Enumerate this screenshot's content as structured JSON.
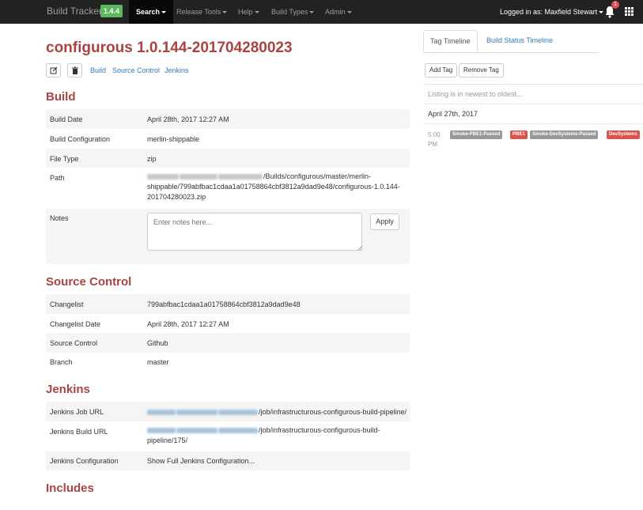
{
  "navbar": {
    "brand": "Build Tracker",
    "version": "1.4.4",
    "menu": [
      {
        "label": "Search",
        "active": true
      },
      {
        "label": "Release Tools",
        "active": false
      },
      {
        "label": "Help",
        "active": false
      },
      {
        "label": "Build Types",
        "active": false
      },
      {
        "label": "Admin",
        "active": false
      }
    ],
    "user": "Logged in as: Maxfield Stewart",
    "notification_count": "1"
  },
  "page": {
    "title": "configurous 1.0.144-201704280023",
    "toolbar_links": [
      "Build",
      "Source Control",
      "Jenkins"
    ]
  },
  "build": {
    "heading": "Build",
    "rows": [
      {
        "label": "Build Date",
        "value": "April 28th, 2017 12:27 AM"
      },
      {
        "label": "Build Configuration",
        "value": "merlin-shippable"
      },
      {
        "label": "File Type",
        "value": "zip"
      },
      {
        "label": "Path",
        "value": "/Builds/configurous/master/merlin-shippable/799abfbac1cdaa1a01758864cbf3812a9dad9e48/configurous-1.0.144-201704280023.zip"
      }
    ],
    "notes_label": "Notes",
    "notes_placeholder": "Enter notes here...",
    "apply_label": "Apply"
  },
  "source_control": {
    "heading": "Source Control",
    "rows": [
      {
        "label": "Changelist",
        "value": "799abfbac1cdaa1a01758864cbf3812a9dad9e48"
      },
      {
        "label": "Changelist Date",
        "value": "April 28th, 2017 12:27 AM"
      },
      {
        "label": "Source Control",
        "value": "Github"
      },
      {
        "label": "Branch",
        "value": "master"
      }
    ]
  },
  "jenkins": {
    "heading": "Jenkins",
    "job_url_label": "Jenkins Job URL",
    "job_url_value": "/job/infrastructurous-configurous-build-pipeline/",
    "build_url_label": "Jenkins Build URL",
    "build_url_value": "/job/infrastructurous-configurous-build-pipeline/175/",
    "config_label": "Jenkins Configuration",
    "config_link": "Show Full Jenkins Configuration..."
  },
  "includes": {
    "heading": "Includes"
  },
  "sidebar": {
    "tabs": [
      "Tag Timeline",
      "Build Status Timeline"
    ],
    "add_tag": "Add Tag",
    "remove_tag": "Remove Tag",
    "listing_text": "Listing is in newest to oldest...",
    "date": "April 27th, 2017",
    "time": "5:00 PM",
    "tags": [
      {
        "label": "Smoke-PBE1-Passed",
        "color": "#999999"
      },
      {
        "label": "PBE1",
        "color": "#d9534f"
      },
      {
        "label": "Smoke-DevSystems-Passed",
        "color": "#999999"
      },
      {
        "label": "DevSystems",
        "color": "#d9534f"
      }
    ]
  },
  "colors": {
    "navbar": "#222222",
    "accent_title": "#a94442",
    "link": "#337ab7",
    "success": "#5cb85c",
    "danger": "#d9534f"
  }
}
